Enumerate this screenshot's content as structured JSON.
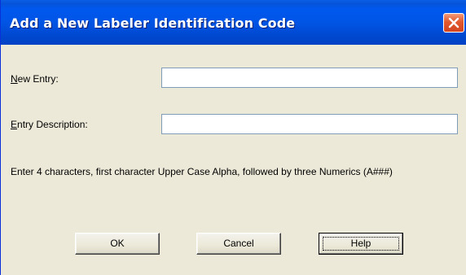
{
  "dialog": {
    "title": "Add a New Labeler Identification Code",
    "close_icon": "close-icon"
  },
  "fields": {
    "new_entry": {
      "label_accel": "N",
      "label_rest": "ew Entry:",
      "value": ""
    },
    "entry_description": {
      "label_accel": "E",
      "label_rest": "ntry Description:",
      "value": ""
    }
  },
  "info_text": "Enter 4 characters, first character Upper Case Alpha, followed by three Numerics (A###)",
  "buttons": {
    "ok": "OK",
    "cancel": "Cancel",
    "help": "Help"
  },
  "colors": {
    "titlebar": "#0055E5",
    "dialog_bg": "#ECE9D8",
    "close_button": "#E2582E"
  }
}
